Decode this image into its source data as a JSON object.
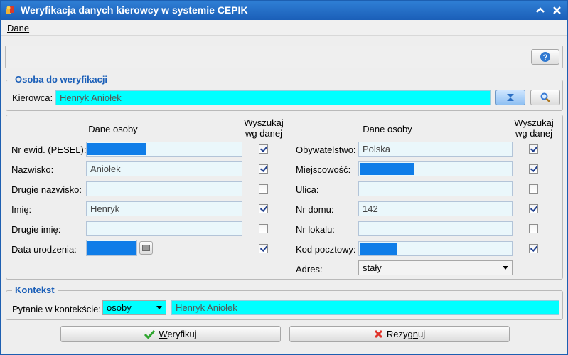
{
  "window": {
    "title": "Weryfikacja danych kierowcy w systemie CEPIK"
  },
  "menu": {
    "dane": "Dane"
  },
  "person_group": {
    "title": "Osoba do weryfikacji",
    "kierowca_label": "Kierowca:",
    "kierowca_value": "Henryk Aniołek"
  },
  "left": {
    "header_data": "Dane osoby",
    "header_search_1": "Wyszukaj",
    "header_search_2": "wg danej",
    "rows": [
      {
        "label": "Nr ewid. (PESEL):",
        "value": "",
        "masked": true,
        "checked": true
      },
      {
        "label": "Nazwisko:",
        "value": "Aniołek",
        "masked": false,
        "checked": true
      },
      {
        "label": "Drugie nazwisko:",
        "value": "",
        "masked": false,
        "checked": false
      },
      {
        "label": "Imię:",
        "value": "Henryk",
        "masked": false,
        "checked": true
      },
      {
        "label": "Drugie imię:",
        "value": "",
        "masked": false,
        "checked": false
      },
      {
        "label": "Data urodzenia:",
        "value": "",
        "masked": true,
        "checked": true
      }
    ]
  },
  "right": {
    "header_data": "Dane osoby",
    "header_search_1": "Wyszukaj",
    "header_search_2": "wg danej",
    "rows": [
      {
        "label": "Obywatelstwo:",
        "value": "Polska",
        "masked": false,
        "checked": true
      },
      {
        "label": "Miejscowość:",
        "value": "",
        "masked": true,
        "checked": true
      },
      {
        "label": "Ulica:",
        "value": "",
        "masked": false,
        "checked": false
      },
      {
        "label": "Nr domu:",
        "value": "142",
        "masked": false,
        "checked": true
      },
      {
        "label": "Nr lokalu:",
        "value": "",
        "masked": false,
        "checked": false
      },
      {
        "label": "Kod pocztowy:",
        "value": "",
        "masked": true,
        "checked": true
      }
    ],
    "adres_label": "Adres:",
    "adres_value": "stały"
  },
  "context_group": {
    "title": "Kontekst",
    "question_label": "Pytanie w kontekście:",
    "question_value": "osoby",
    "context_value": "Henryk Aniołek"
  },
  "buttons": {
    "verify_prefix": "",
    "verify_underlined": "W",
    "verify_rest": "eryfikuj",
    "cancel_prefix": "Rezyg",
    "cancel_underlined": "n",
    "cancel_rest": "uj"
  },
  "colors": {
    "highlight": "#00ffff",
    "masked": "#0f7de8",
    "accent": "#1b5fb8"
  }
}
